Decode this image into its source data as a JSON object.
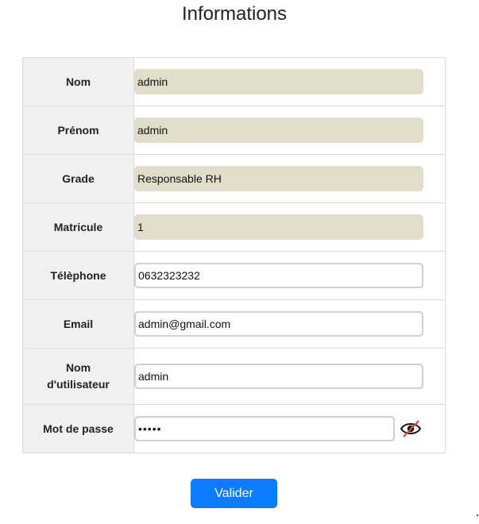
{
  "page": {
    "title": "Informations"
  },
  "form": {
    "nom": {
      "label": "Nom",
      "value": "admin"
    },
    "prenom": {
      "label": "Prénom",
      "value": "admin"
    },
    "grade": {
      "label": "Grade",
      "value": "Responsable RH"
    },
    "matricule": {
      "label": "Matricule",
      "value": "1"
    },
    "telephone": {
      "label": "Télèphone",
      "value": "0632323232"
    },
    "email": {
      "label": "Email",
      "value": "admin@gmail.com"
    },
    "username": {
      "label_line1": "Nom",
      "label_line2": "d'utilisateur",
      "value": "admin"
    },
    "password": {
      "label": "Mot de passe",
      "value": "admin",
      "toggle_icon": "eye-slash-icon"
    }
  },
  "actions": {
    "submit_label": "Valider"
  },
  "colors": {
    "readonly_bg": "#dedec9",
    "label_bg": "#f0f0f0",
    "button_bg": "#0b7bff",
    "eye_slash": "#e0442a"
  }
}
